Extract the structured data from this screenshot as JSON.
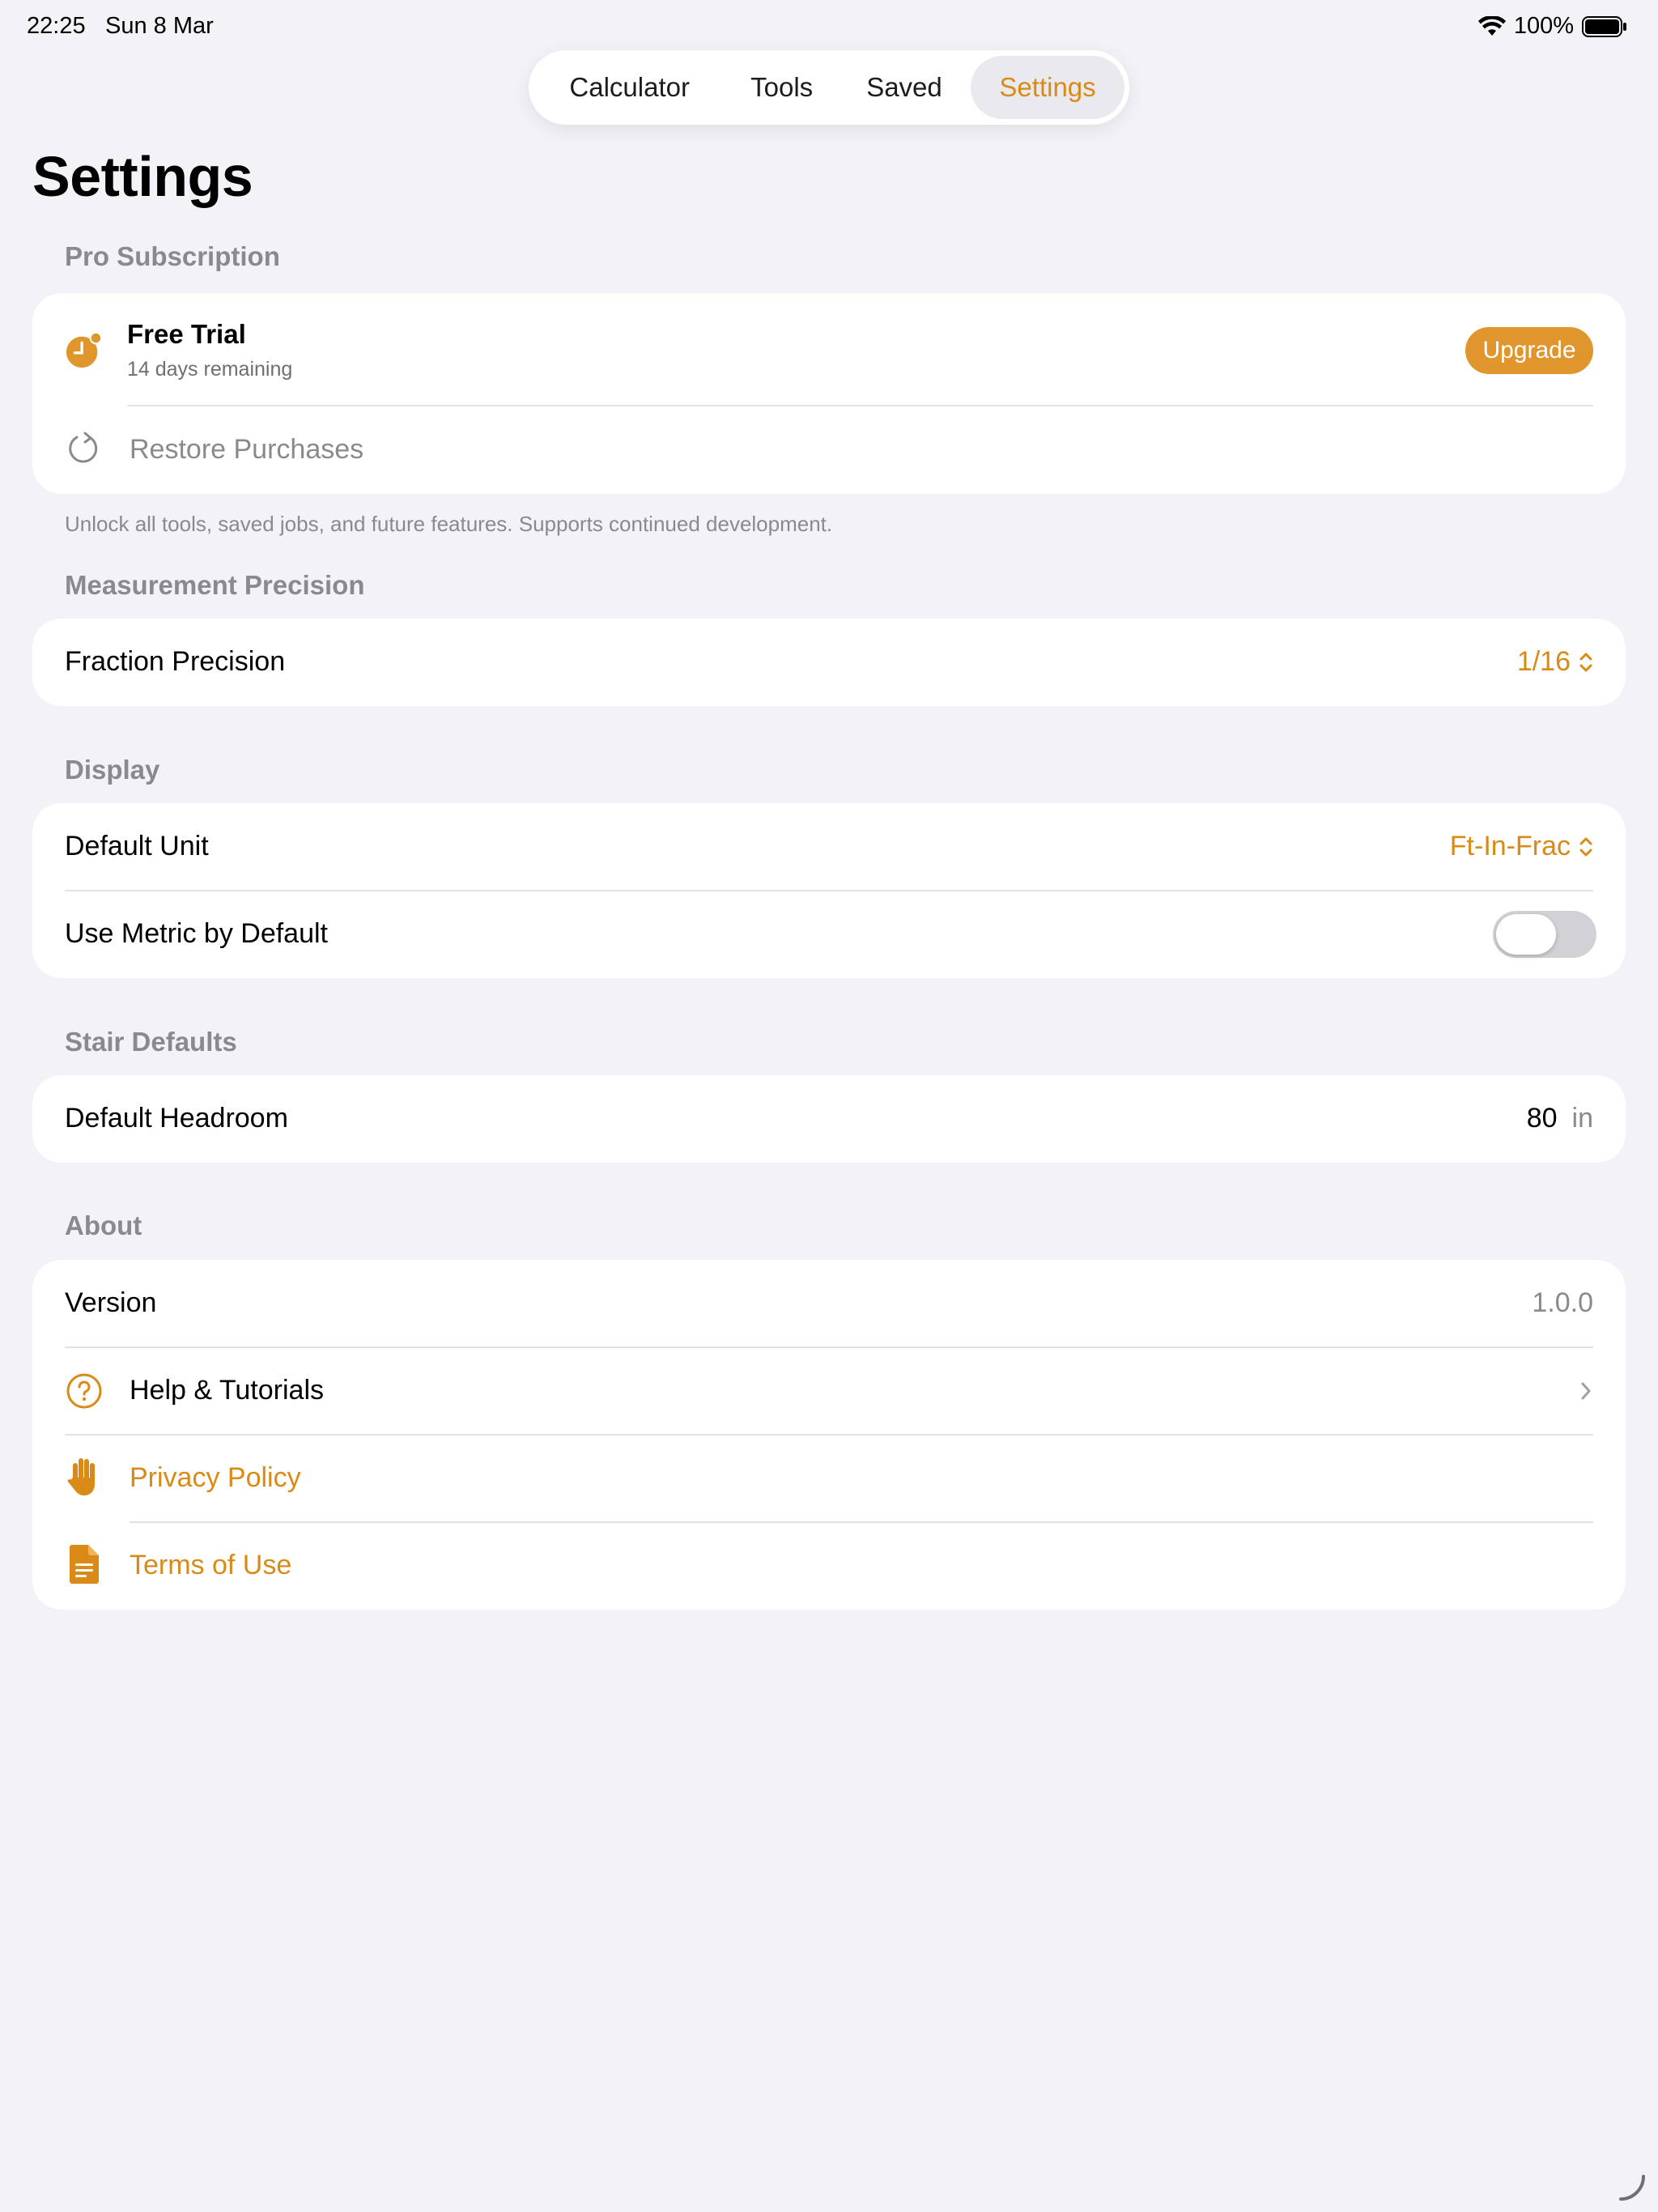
{
  "status_bar": {
    "time": "22:25",
    "date": "Sun 8 Mar",
    "battery": "100%"
  },
  "tabs": [
    {
      "label": "Calculator",
      "active": false
    },
    {
      "label": "Tools",
      "active": false
    },
    {
      "label": "Saved",
      "active": false
    },
    {
      "label": "Settings",
      "active": true
    }
  ],
  "page_title": "Settings",
  "sections": {
    "pro": {
      "header": "Pro Subscription",
      "trial_title": "Free Trial",
      "trial_subtitle": "14 days remaining",
      "upgrade_label": "Upgrade",
      "restore_label": "Restore Purchases",
      "footer": "Unlock all tools, saved jobs, and future features. Supports continued development."
    },
    "precision": {
      "header": "Measurement Precision",
      "fraction_label": "Fraction Precision",
      "fraction_value": "1/16"
    },
    "display": {
      "header": "Display",
      "unit_label": "Default Unit",
      "unit_value": "Ft-In-Frac",
      "metric_label": "Use Metric by Default",
      "metric_on": false
    },
    "stairs": {
      "header": "Stair Defaults",
      "headroom_label": "Default Headroom",
      "headroom_value": "80",
      "headroom_unit": "in"
    },
    "about": {
      "header": "About",
      "version_label": "Version",
      "version_value": "1.0.0",
      "help_label": "Help & Tutorials",
      "privacy_label": "Privacy Policy",
      "terms_label": "Terms of Use"
    }
  },
  "colors": {
    "accent": "#d98a17",
    "background": "#f2f2f7",
    "card": "#ffffff",
    "secondary_text": "#8a8a8e"
  }
}
